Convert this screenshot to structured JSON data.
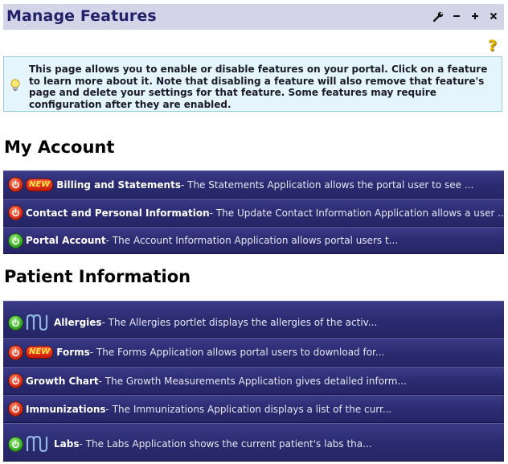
{
  "header": {
    "title": "Manage Features"
  },
  "info": {
    "text": "This page allows you to enable or disable features on your portal. Click on a feature to learn more about it. Note that disabling a feature will also remove that feature's page and delete your settings for that feature. Some features may require configuration after they are enabled."
  },
  "sections": [
    {
      "heading": "My Account",
      "items": [
        {
          "name": "Billing and Statements",
          "desc": " - The Statements Application allows the portal user to see ...",
          "status": "off",
          "new": true,
          "logo": false
        },
        {
          "name": "Contact and Personal Information",
          "desc": " - The Update Contact Information Application allows a user ...",
          "status": "off",
          "new": false,
          "logo": false
        },
        {
          "name": "Portal Account",
          "desc": " - The Account Information Application allows portal users t...",
          "status": "on",
          "new": false,
          "logo": false
        }
      ]
    },
    {
      "heading": "Patient Information",
      "items": [
        {
          "name": "Allergies",
          "desc": " - The Allergies portlet displays the allergies of the activ...",
          "status": "on",
          "new": false,
          "logo": true
        },
        {
          "name": "Forms",
          "desc": " - The Forms Application allows portal users to download for...",
          "status": "off",
          "new": true,
          "logo": false
        },
        {
          "name": "Growth Chart",
          "desc": " - The Growth Measurements Application gives detailed inform...",
          "status": "off",
          "new": false,
          "logo": false
        },
        {
          "name": "Immunizations",
          "desc": " - The Immunizations Application displays a list of the curr...",
          "status": "off",
          "new": false,
          "logo": false
        },
        {
          "name": "Labs",
          "desc": " - The Labs Application shows the current patient's labs tha...",
          "status": "on",
          "new": false,
          "logo": true
        }
      ]
    }
  ],
  "badge": {
    "new_label": "NEW"
  },
  "icons": {
    "wrench": "wrench-icon",
    "minimize": "minimize-icon",
    "maximize": "plus-icon",
    "close": "close-icon",
    "help": "question-mark-icon",
    "info": "lightbulb-icon",
    "power_on_color": "#3fb52c",
    "power_off_color": "#e0341c"
  }
}
